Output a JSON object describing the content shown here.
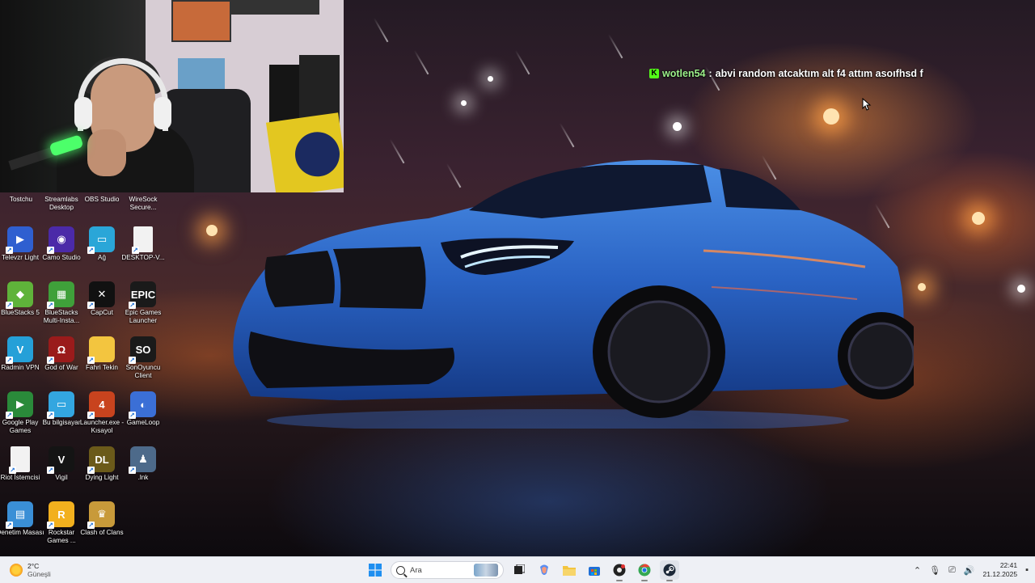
{
  "chat": {
    "badge": "K",
    "username": "wotlen54",
    "separator": ":",
    "message": "abvi random atcaktım alt f4 attım asoıfhsd f"
  },
  "desktop": {
    "top_labels": [
      "Tostchu",
      "Streamlabs Desktop",
      "OBS Studio",
      "WireSock Secure..."
    ],
    "icons": [
      {
        "label": "Televzr Light",
        "icon": "televzr-icon",
        "color": "#2f5fd0",
        "glyph": "▶"
      },
      {
        "label": "Camo Studio",
        "icon": "camo-icon",
        "color": "#4b2aa8",
        "glyph": "◉"
      },
      {
        "label": "Ağ",
        "icon": "network-icon",
        "color": "#2aa6d8",
        "glyph": "▭"
      },
      {
        "label": "DESKTOP-V...",
        "icon": "file-icon",
        "color": "#f2f2f2",
        "glyph": ""
      },
      {
        "label": "BlueStacks 5",
        "icon": "bluestacks-icon",
        "color": "#5fb33a",
        "glyph": "◆"
      },
      {
        "label": "BlueStacks Multi-Insta...",
        "icon": "bluestacks-multi-icon",
        "color": "#3fa03a",
        "glyph": "▦"
      },
      {
        "label": "CapCut",
        "icon": "capcut-icon",
        "color": "#111111",
        "glyph": "✕"
      },
      {
        "label": "Epic Games Launcher",
        "icon": "epic-games-icon",
        "color": "#1a1a1a",
        "glyph": "EPIC"
      },
      {
        "label": "Radmin VPN",
        "icon": "radmin-vpn-icon",
        "color": "#25a0d8",
        "glyph": "V"
      },
      {
        "label": "God of War",
        "icon": "god-of-war-icon",
        "color": "#9a1b1b",
        "glyph": "Ω"
      },
      {
        "label": "Fahri Tekin",
        "icon": "folder-icon",
        "color": "#f3c53f",
        "glyph": ""
      },
      {
        "label": "SonOyuncu Client",
        "icon": "sonoyuncu-icon",
        "color": "#1a1a1a",
        "glyph": "SO"
      },
      {
        "label": "Google Play Games",
        "icon": "google-play-games-icon",
        "color": "#2a8a3a",
        "glyph": "▶"
      },
      {
        "label": "Bu bilgisayar",
        "icon": "this-pc-icon",
        "color": "#33a6e0",
        "glyph": "▭"
      },
      {
        "label": "Launcher.exe - Kısayol",
        "icon": "launcher-icon",
        "color": "#c8431e",
        "glyph": "4"
      },
      {
        "label": "GameLoop",
        "icon": "gameloop-icon",
        "color": "#3b6fd6",
        "glyph": "◐"
      },
      {
        "label": "Riot İstemcisi",
        "icon": "riot-file-icon",
        "color": "#f2f2f2",
        "glyph": ""
      },
      {
        "label": "Vigil",
        "icon": "vigil-icon",
        "color": "#141414",
        "glyph": "V"
      },
      {
        "label": "Dying Light",
        "icon": "dying-light-icon",
        "color": "#6b5a1a",
        "glyph": "DL"
      },
      {
        "label": ".lnk",
        "icon": "pubg-icon",
        "color": "#4d6a8a",
        "glyph": "♟"
      },
      {
        "label": "Denetim Masası",
        "icon": "control-panel-icon",
        "color": "#3a8fd6",
        "glyph": "▤"
      },
      {
        "label": "Rockstar Games ...",
        "icon": "rockstar-icon",
        "color": "#f2b01e",
        "glyph": "R"
      },
      {
        "label": "Clash of Clans",
        "icon": "clash-of-clans-icon",
        "color": "#c89a3a",
        "glyph": "♛"
      }
    ]
  },
  "taskbar": {
    "weather_temp": "2°C",
    "weather_desc": "Güneşli",
    "search_placeholder": "Ara",
    "apps": [
      "windows-start-icon",
      "task-view-icon",
      "copilot-icon",
      "file-explorer-icon",
      "microsoft-store-icon",
      "obs-taskbar-icon",
      "chrome-icon",
      "steam-icon"
    ],
    "time": "22:41",
    "date": "21.12.2025"
  }
}
